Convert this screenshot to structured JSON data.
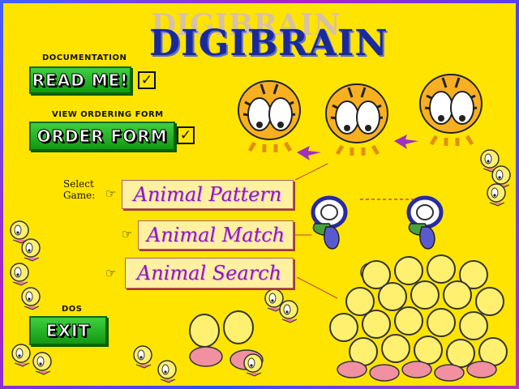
{
  "app": {
    "title": "DIGIBRAIN"
  },
  "documentation": {
    "caption": "DOCUMENTATION",
    "button": "READ ME!",
    "check": "✓"
  },
  "ordering": {
    "caption": "VIEW ORDERING FORM",
    "button": "ORDER FORM",
    "check": "✓"
  },
  "games": {
    "select_label_1": "Select",
    "select_label_2": "Game:",
    "pointer": "☞",
    "items": [
      "Animal Pattern",
      "Animal Match",
      "Animal Search"
    ]
  },
  "dos": {
    "caption": "DOS",
    "button": "EXIT"
  },
  "colors": {
    "background": "#ffe400",
    "button_green": "#1fb01f",
    "title_blue": "#1a2a9a",
    "game_text": "#8a1fb0"
  }
}
